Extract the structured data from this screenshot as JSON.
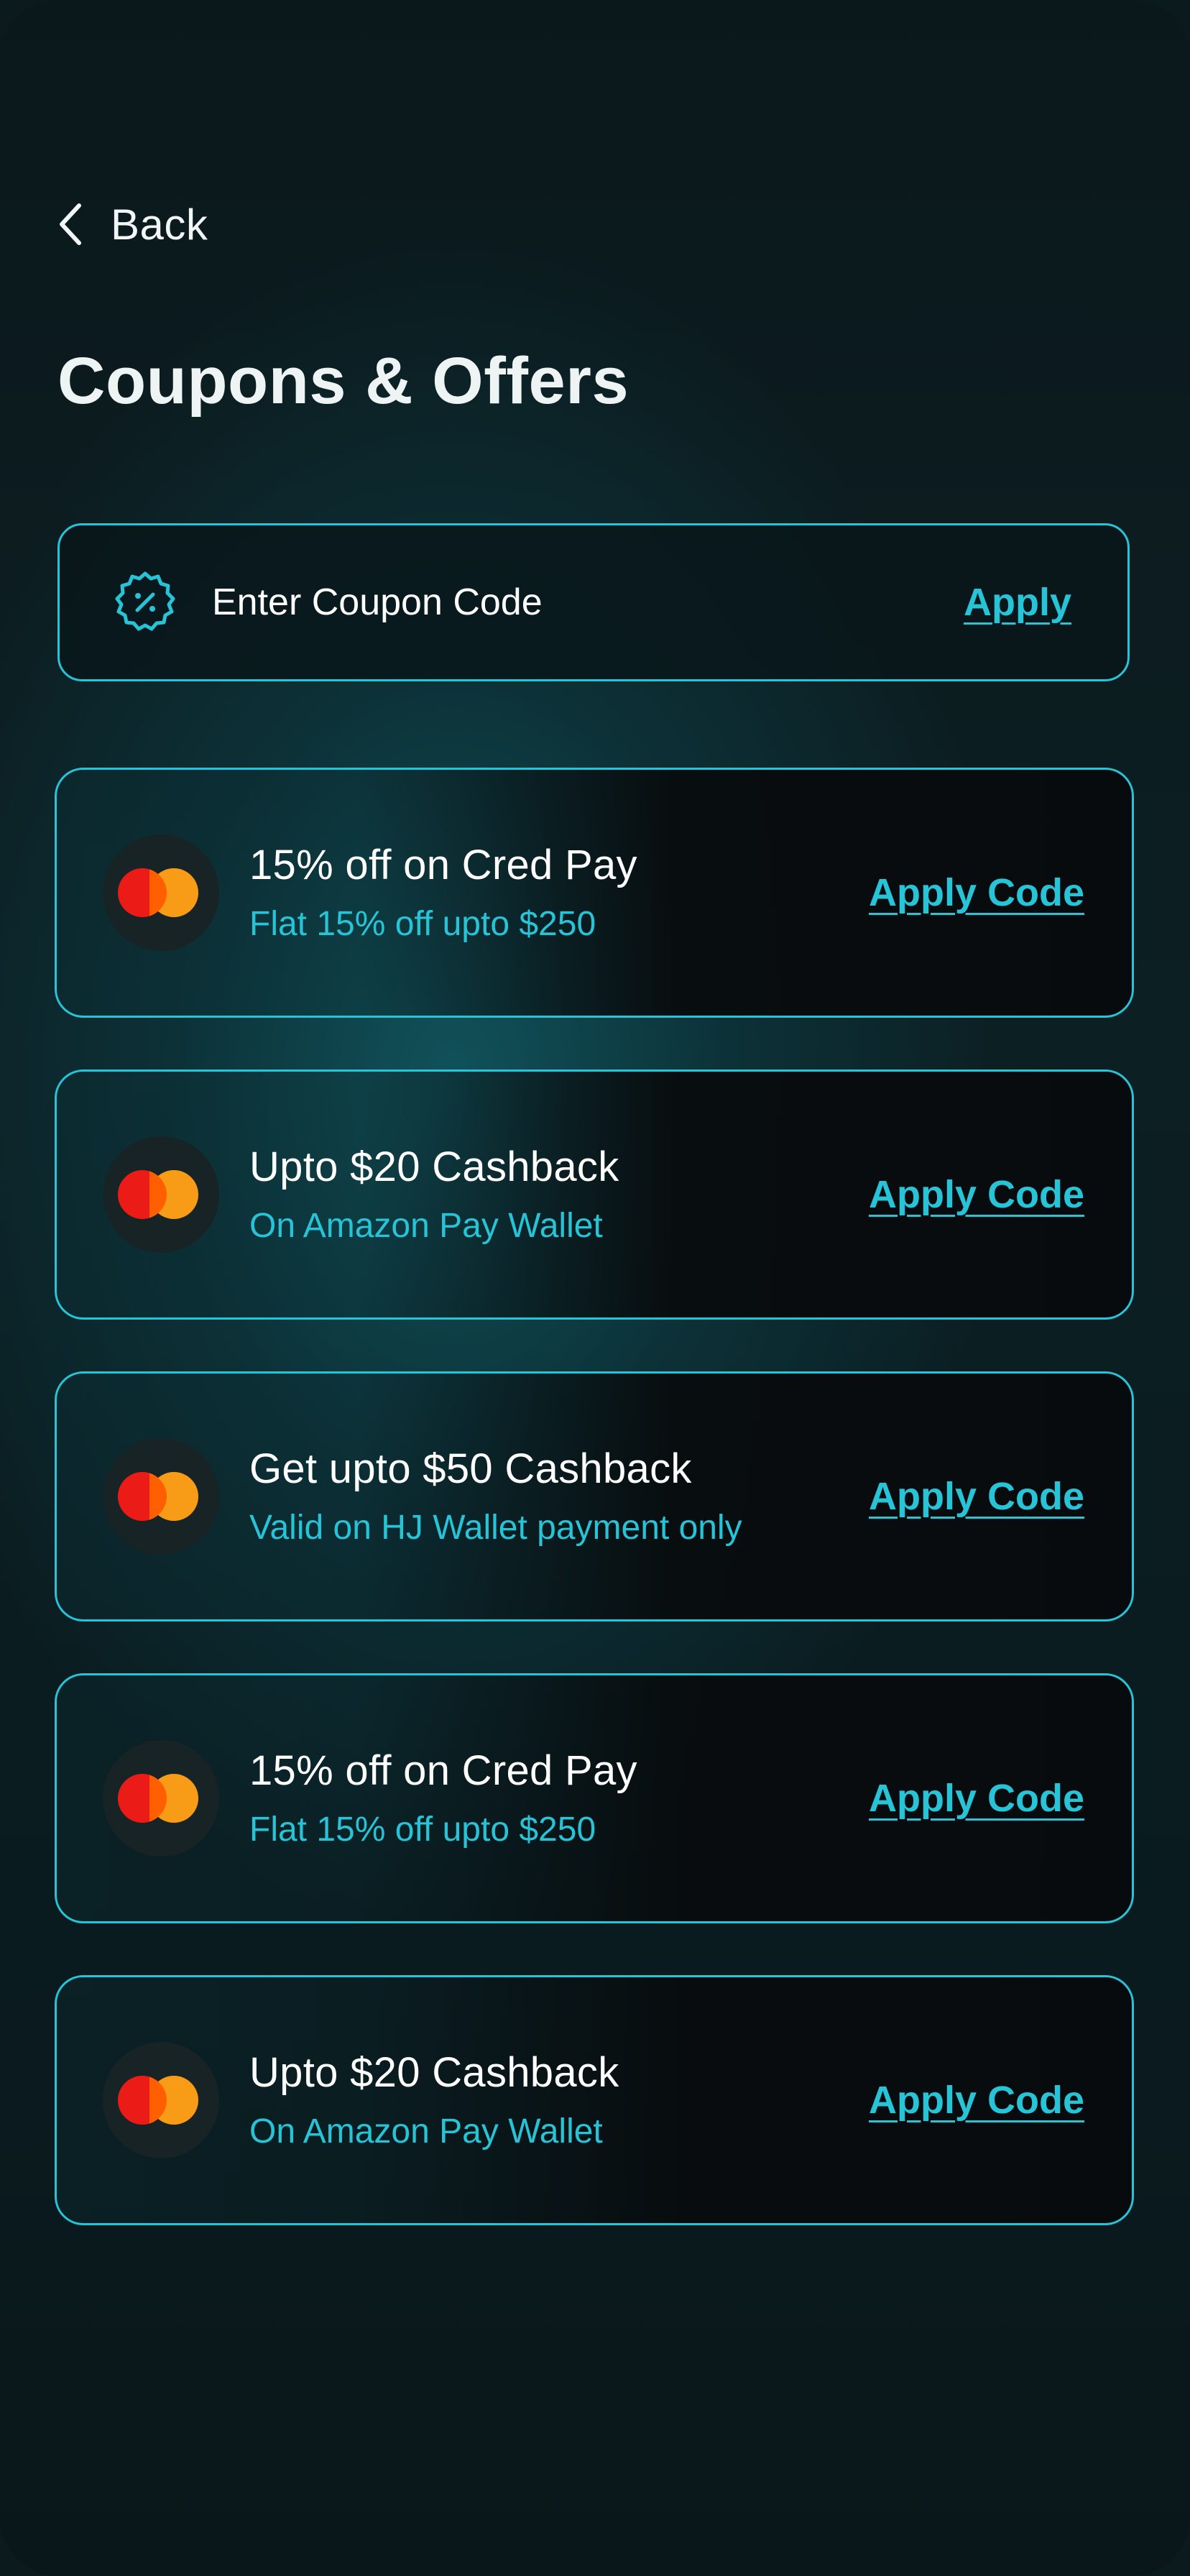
{
  "header": {
    "back_label": "Back",
    "title": "Coupons & Offers"
  },
  "coupon_entry": {
    "placeholder": "Enter Coupon Code",
    "apply_label": "Apply",
    "icon": "discount-badge-icon"
  },
  "offers": [
    {
      "title": "15% off on Cred Pay",
      "subtitle": "Flat 15% off upto $250",
      "action": "Apply Code",
      "icon": "mastercard-logo-icon"
    },
    {
      "title": "Upto $20 Cashback",
      "subtitle": "On Amazon Pay Wallet",
      "action": "Apply Code",
      "icon": "mastercard-logo-icon"
    },
    {
      "title": "Get upto $50 Cashback",
      "subtitle": "Valid on HJ Wallet payment only",
      "action": "Apply Code",
      "icon": "mastercard-logo-icon"
    },
    {
      "title": "15% off on Cred Pay",
      "subtitle": "Flat 15% off upto $250",
      "action": "Apply Code",
      "icon": "mastercard-logo-icon"
    },
    {
      "title": "Upto $20 Cashback",
      "subtitle": "On Amazon Pay Wallet",
      "action": "Apply Code",
      "icon": "mastercard-logo-icon"
    }
  ],
  "colors": {
    "accent": "#27c3d6",
    "background": "#0b1a1d",
    "card_dark": "#080b0d",
    "text": "#ffffff",
    "brand_red": "#eb1c17",
    "brand_orange": "#f89c17"
  }
}
